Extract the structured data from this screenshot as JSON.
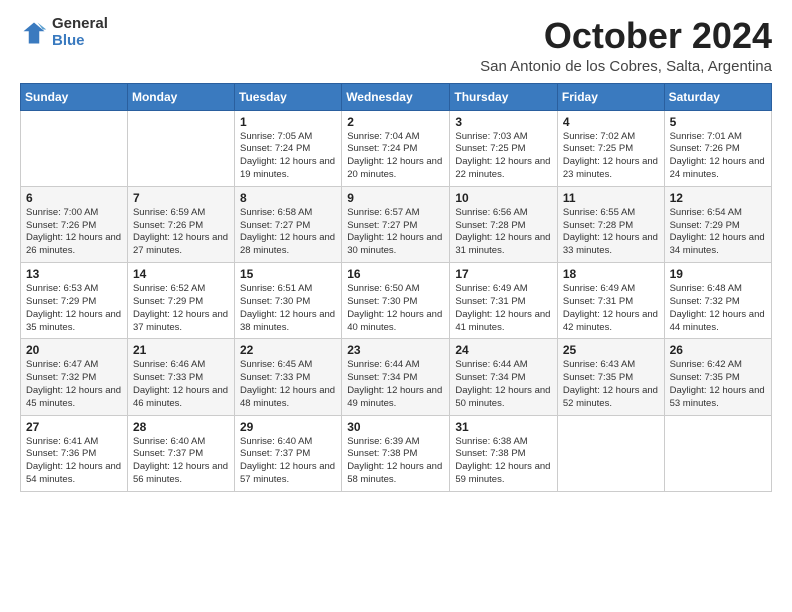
{
  "logo": {
    "general": "General",
    "blue": "Blue"
  },
  "header": {
    "month": "October 2024",
    "location": "San Antonio de los Cobres, Salta, Argentina"
  },
  "weekdays": [
    "Sunday",
    "Monday",
    "Tuesday",
    "Wednesday",
    "Thursday",
    "Friday",
    "Saturday"
  ],
  "weeks": [
    [
      {
        "day": "",
        "sunrise": "",
        "sunset": "",
        "daylight": ""
      },
      {
        "day": "",
        "sunrise": "",
        "sunset": "",
        "daylight": ""
      },
      {
        "day": "1",
        "sunrise": "Sunrise: 7:05 AM",
        "sunset": "Sunset: 7:24 PM",
        "daylight": "Daylight: 12 hours and 19 minutes."
      },
      {
        "day": "2",
        "sunrise": "Sunrise: 7:04 AM",
        "sunset": "Sunset: 7:24 PM",
        "daylight": "Daylight: 12 hours and 20 minutes."
      },
      {
        "day": "3",
        "sunrise": "Sunrise: 7:03 AM",
        "sunset": "Sunset: 7:25 PM",
        "daylight": "Daylight: 12 hours and 22 minutes."
      },
      {
        "day": "4",
        "sunrise": "Sunrise: 7:02 AM",
        "sunset": "Sunset: 7:25 PM",
        "daylight": "Daylight: 12 hours and 23 minutes."
      },
      {
        "day": "5",
        "sunrise": "Sunrise: 7:01 AM",
        "sunset": "Sunset: 7:26 PM",
        "daylight": "Daylight: 12 hours and 24 minutes."
      }
    ],
    [
      {
        "day": "6",
        "sunrise": "Sunrise: 7:00 AM",
        "sunset": "Sunset: 7:26 PM",
        "daylight": "Daylight: 12 hours and 26 minutes."
      },
      {
        "day": "7",
        "sunrise": "Sunrise: 6:59 AM",
        "sunset": "Sunset: 7:26 PM",
        "daylight": "Daylight: 12 hours and 27 minutes."
      },
      {
        "day": "8",
        "sunrise": "Sunrise: 6:58 AM",
        "sunset": "Sunset: 7:27 PM",
        "daylight": "Daylight: 12 hours and 28 minutes."
      },
      {
        "day": "9",
        "sunrise": "Sunrise: 6:57 AM",
        "sunset": "Sunset: 7:27 PM",
        "daylight": "Daylight: 12 hours and 30 minutes."
      },
      {
        "day": "10",
        "sunrise": "Sunrise: 6:56 AM",
        "sunset": "Sunset: 7:28 PM",
        "daylight": "Daylight: 12 hours and 31 minutes."
      },
      {
        "day": "11",
        "sunrise": "Sunrise: 6:55 AM",
        "sunset": "Sunset: 7:28 PM",
        "daylight": "Daylight: 12 hours and 33 minutes."
      },
      {
        "day": "12",
        "sunrise": "Sunrise: 6:54 AM",
        "sunset": "Sunset: 7:29 PM",
        "daylight": "Daylight: 12 hours and 34 minutes."
      }
    ],
    [
      {
        "day": "13",
        "sunrise": "Sunrise: 6:53 AM",
        "sunset": "Sunset: 7:29 PM",
        "daylight": "Daylight: 12 hours and 35 minutes."
      },
      {
        "day": "14",
        "sunrise": "Sunrise: 6:52 AM",
        "sunset": "Sunset: 7:29 PM",
        "daylight": "Daylight: 12 hours and 37 minutes."
      },
      {
        "day": "15",
        "sunrise": "Sunrise: 6:51 AM",
        "sunset": "Sunset: 7:30 PM",
        "daylight": "Daylight: 12 hours and 38 minutes."
      },
      {
        "day": "16",
        "sunrise": "Sunrise: 6:50 AM",
        "sunset": "Sunset: 7:30 PM",
        "daylight": "Daylight: 12 hours and 40 minutes."
      },
      {
        "day": "17",
        "sunrise": "Sunrise: 6:49 AM",
        "sunset": "Sunset: 7:31 PM",
        "daylight": "Daylight: 12 hours and 41 minutes."
      },
      {
        "day": "18",
        "sunrise": "Sunrise: 6:49 AM",
        "sunset": "Sunset: 7:31 PM",
        "daylight": "Daylight: 12 hours and 42 minutes."
      },
      {
        "day": "19",
        "sunrise": "Sunrise: 6:48 AM",
        "sunset": "Sunset: 7:32 PM",
        "daylight": "Daylight: 12 hours and 44 minutes."
      }
    ],
    [
      {
        "day": "20",
        "sunrise": "Sunrise: 6:47 AM",
        "sunset": "Sunset: 7:32 PM",
        "daylight": "Daylight: 12 hours and 45 minutes."
      },
      {
        "day": "21",
        "sunrise": "Sunrise: 6:46 AM",
        "sunset": "Sunset: 7:33 PM",
        "daylight": "Daylight: 12 hours and 46 minutes."
      },
      {
        "day": "22",
        "sunrise": "Sunrise: 6:45 AM",
        "sunset": "Sunset: 7:33 PM",
        "daylight": "Daylight: 12 hours and 48 minutes."
      },
      {
        "day": "23",
        "sunrise": "Sunrise: 6:44 AM",
        "sunset": "Sunset: 7:34 PM",
        "daylight": "Daylight: 12 hours and 49 minutes."
      },
      {
        "day": "24",
        "sunrise": "Sunrise: 6:44 AM",
        "sunset": "Sunset: 7:34 PM",
        "daylight": "Daylight: 12 hours and 50 minutes."
      },
      {
        "day": "25",
        "sunrise": "Sunrise: 6:43 AM",
        "sunset": "Sunset: 7:35 PM",
        "daylight": "Daylight: 12 hours and 52 minutes."
      },
      {
        "day": "26",
        "sunrise": "Sunrise: 6:42 AM",
        "sunset": "Sunset: 7:35 PM",
        "daylight": "Daylight: 12 hours and 53 minutes."
      }
    ],
    [
      {
        "day": "27",
        "sunrise": "Sunrise: 6:41 AM",
        "sunset": "Sunset: 7:36 PM",
        "daylight": "Daylight: 12 hours and 54 minutes."
      },
      {
        "day": "28",
        "sunrise": "Sunrise: 6:40 AM",
        "sunset": "Sunset: 7:37 PM",
        "daylight": "Daylight: 12 hours and 56 minutes."
      },
      {
        "day": "29",
        "sunrise": "Sunrise: 6:40 AM",
        "sunset": "Sunset: 7:37 PM",
        "daylight": "Daylight: 12 hours and 57 minutes."
      },
      {
        "day": "30",
        "sunrise": "Sunrise: 6:39 AM",
        "sunset": "Sunset: 7:38 PM",
        "daylight": "Daylight: 12 hours and 58 minutes."
      },
      {
        "day": "31",
        "sunrise": "Sunrise: 6:38 AM",
        "sunset": "Sunset: 7:38 PM",
        "daylight": "Daylight: 12 hours and 59 minutes."
      },
      {
        "day": "",
        "sunrise": "",
        "sunset": "",
        "daylight": ""
      },
      {
        "day": "",
        "sunrise": "",
        "sunset": "",
        "daylight": ""
      }
    ]
  ]
}
